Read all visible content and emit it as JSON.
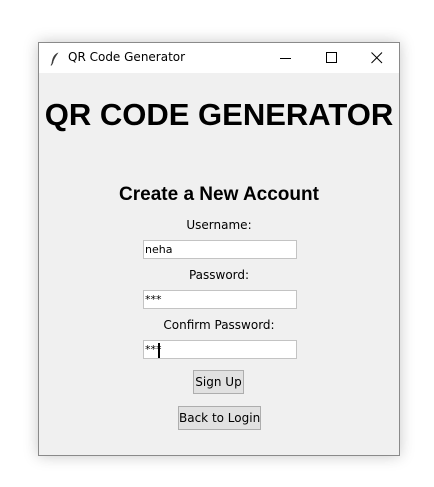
{
  "window": {
    "title": "QR Code Generator",
    "icon": "feather-icon",
    "controls": [
      "minimize-icon",
      "maximize-icon",
      "close-icon"
    ]
  },
  "main": {
    "heading": "QR CODE GENERATOR",
    "subheading": "Create a New Account",
    "username": {
      "label": "Username:",
      "value": "neha"
    },
    "password": {
      "label": "Password:",
      "value": "***"
    },
    "confirm_password": {
      "label": "Confirm Password:",
      "value": "***"
    },
    "signup_label": "Sign Up",
    "back_label": "Back to Login"
  },
  "colors": {
    "window_bg": "#f0f0f0",
    "titlebar_bg": "#ffffff",
    "button_bg": "#e1e1e1",
    "button_border": "#adadad"
  }
}
